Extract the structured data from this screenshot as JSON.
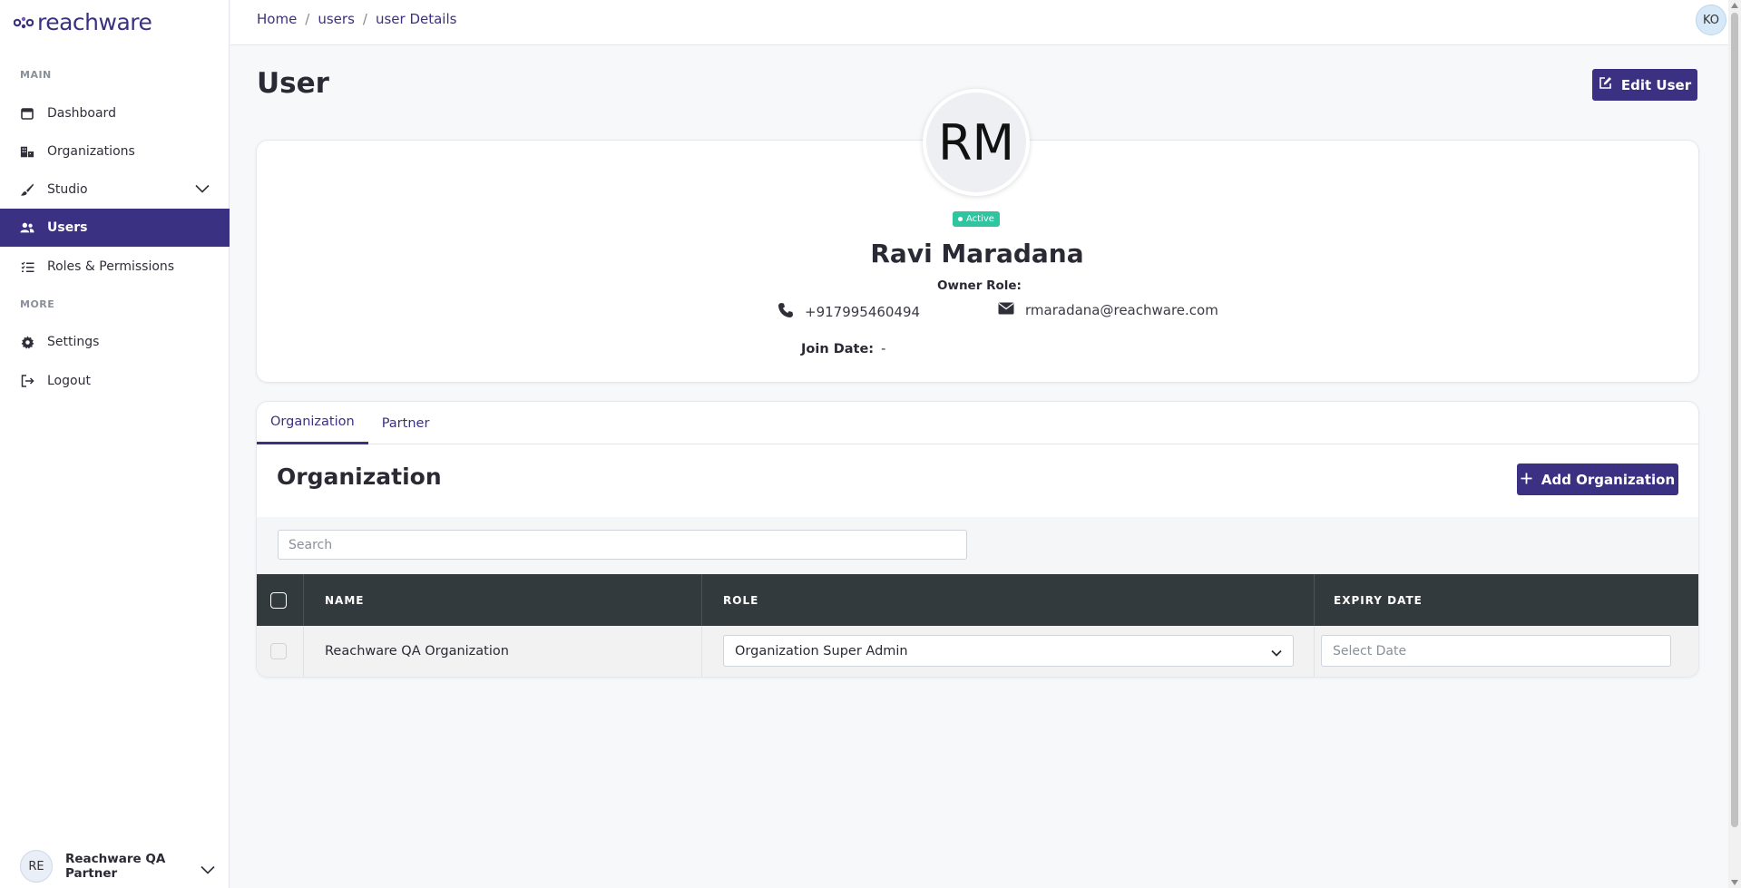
{
  "brand": {
    "name": "reachware",
    "color": "#3b3182"
  },
  "sidebar": {
    "sections": {
      "main": "MAIN",
      "more": "MORE"
    },
    "items": [
      {
        "label": "Dashboard",
        "icon": "calendar-icon"
      },
      {
        "label": "Organizations",
        "icon": "building-icon"
      },
      {
        "label": "Studio",
        "icon": "brush-icon"
      },
      {
        "label": "Users",
        "icon": "users-icon",
        "active": true
      },
      {
        "label": "Roles & Permissions",
        "icon": "checklist-icon"
      },
      {
        "label": "Settings",
        "icon": "gear-icon"
      },
      {
        "label": "Logout",
        "icon": "logout-icon"
      }
    ],
    "footer": {
      "initials": "RE",
      "name": "Reachware QA Partner"
    }
  },
  "topbar": {
    "breadcrumb": [
      "Home",
      "users",
      "user Details"
    ],
    "avatar_initials": "KO"
  },
  "page": {
    "title": "User",
    "edit_button": "Edit User"
  },
  "profile": {
    "initials": "RM",
    "status": "Active",
    "name": "Ravi Maradana",
    "owner_role_label": "Owner Role:",
    "phone": "+917995460494",
    "email": "rmaradana@reachware.com",
    "join_date_label": "Join Date:",
    "join_date_value": "-"
  },
  "tabs": {
    "items": [
      "Organization",
      "Partner"
    ],
    "active": "Organization"
  },
  "organization": {
    "title": "Organization",
    "add_button": "Add Organization",
    "search_placeholder": "Search",
    "columns": [
      "NAME",
      "ROLE",
      "EXPIRY DATE"
    ],
    "rows": [
      {
        "name": "Reachware QA Organization",
        "role": "Organization Super Admin",
        "expiry_placeholder": "Select Date"
      }
    ]
  },
  "colors": {
    "accent": "#3b3182",
    "active_badge": "#2ec5a0",
    "table_header": "#333a3e"
  }
}
